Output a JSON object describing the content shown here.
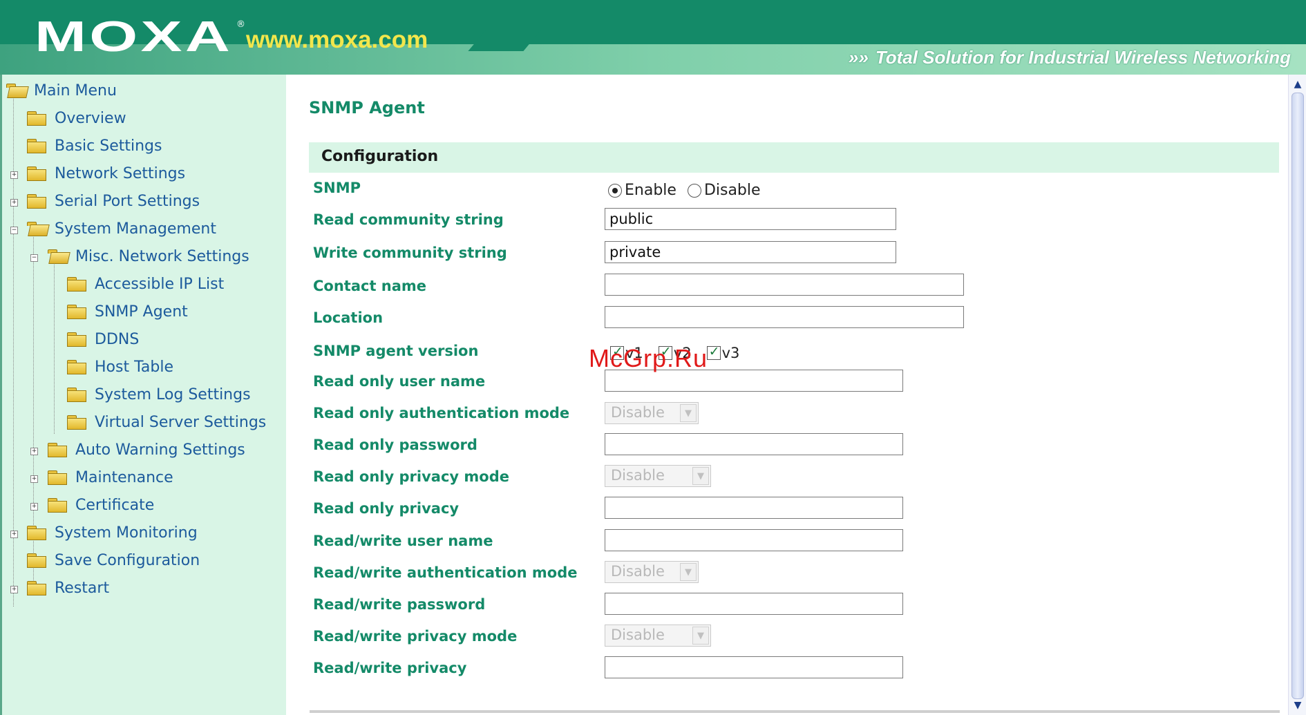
{
  "header": {
    "logo": "MOXA",
    "logo_reg": "®",
    "url": "www.moxa.com",
    "tagline": "Total Solution for Industrial Wireless Networking",
    "tagline_chevron": "»»"
  },
  "sidebar": {
    "items": [
      {
        "label": "Main Menu"
      },
      {
        "label": "Overview"
      },
      {
        "label": "Basic Settings"
      },
      {
        "label": "Network Settings"
      },
      {
        "label": "Serial Port Settings"
      },
      {
        "label": "System Management"
      },
      {
        "label": "Misc. Network Settings"
      },
      {
        "label": "Accessible IP List"
      },
      {
        "label": "SNMP Agent"
      },
      {
        "label": "DDNS"
      },
      {
        "label": "Host Table"
      },
      {
        "label": "System Log Settings"
      },
      {
        "label": "Virtual Server Settings"
      },
      {
        "label": "Auto Warning Settings"
      },
      {
        "label": "Maintenance"
      },
      {
        "label": "Certificate"
      },
      {
        "label": "System Monitoring"
      },
      {
        "label": "Save Configuration"
      },
      {
        "label": "Restart"
      }
    ]
  },
  "main": {
    "title": "SNMP Agent",
    "section": "Configuration",
    "snmp": {
      "label": "SNMP",
      "enable": "Enable",
      "disable": "Disable",
      "selected": "Enable"
    },
    "read_community": {
      "label": "Read community string",
      "value": "public"
    },
    "write_community": {
      "label": "Write community string",
      "value": "private"
    },
    "contact": {
      "label": "Contact name",
      "value": ""
    },
    "location": {
      "label": "Location",
      "value": ""
    },
    "version": {
      "label": "SNMP agent version",
      "options": [
        {
          "label": "v1",
          "checked": true
        },
        {
          "label": "v2",
          "checked": true
        },
        {
          "label": "v3",
          "checked": true
        }
      ]
    },
    "ro_user": {
      "label": "Read only user name",
      "value": ""
    },
    "ro_auth_mode": {
      "label": "Read only authentication mode",
      "value": "Disable"
    },
    "ro_password": {
      "label": "Read only password",
      "value": ""
    },
    "ro_privacy_mode": {
      "label": "Read only privacy mode",
      "value": "Disable"
    },
    "ro_privacy": {
      "label": "Read only privacy",
      "value": ""
    },
    "rw_user": {
      "label": "Read/write user name",
      "value": ""
    },
    "rw_auth_mode": {
      "label": "Read/write authentication mode",
      "value": "Disable"
    },
    "rw_password": {
      "label": "Read/write password",
      "value": ""
    },
    "rw_privacy_mode": {
      "label": "Read/write privacy mode",
      "value": "Disable"
    },
    "rw_privacy": {
      "label": "Read/write privacy",
      "value": ""
    }
  },
  "watermark": "McGrp.Ru",
  "scrollbar": {
    "up": "▲",
    "down": "▼"
  },
  "colors": {
    "brand_green": "#148a68",
    "sidebar_bg": "#d9f5e6",
    "link_blue": "#1c5a9c",
    "url_yellow": "#f2e64c"
  }
}
